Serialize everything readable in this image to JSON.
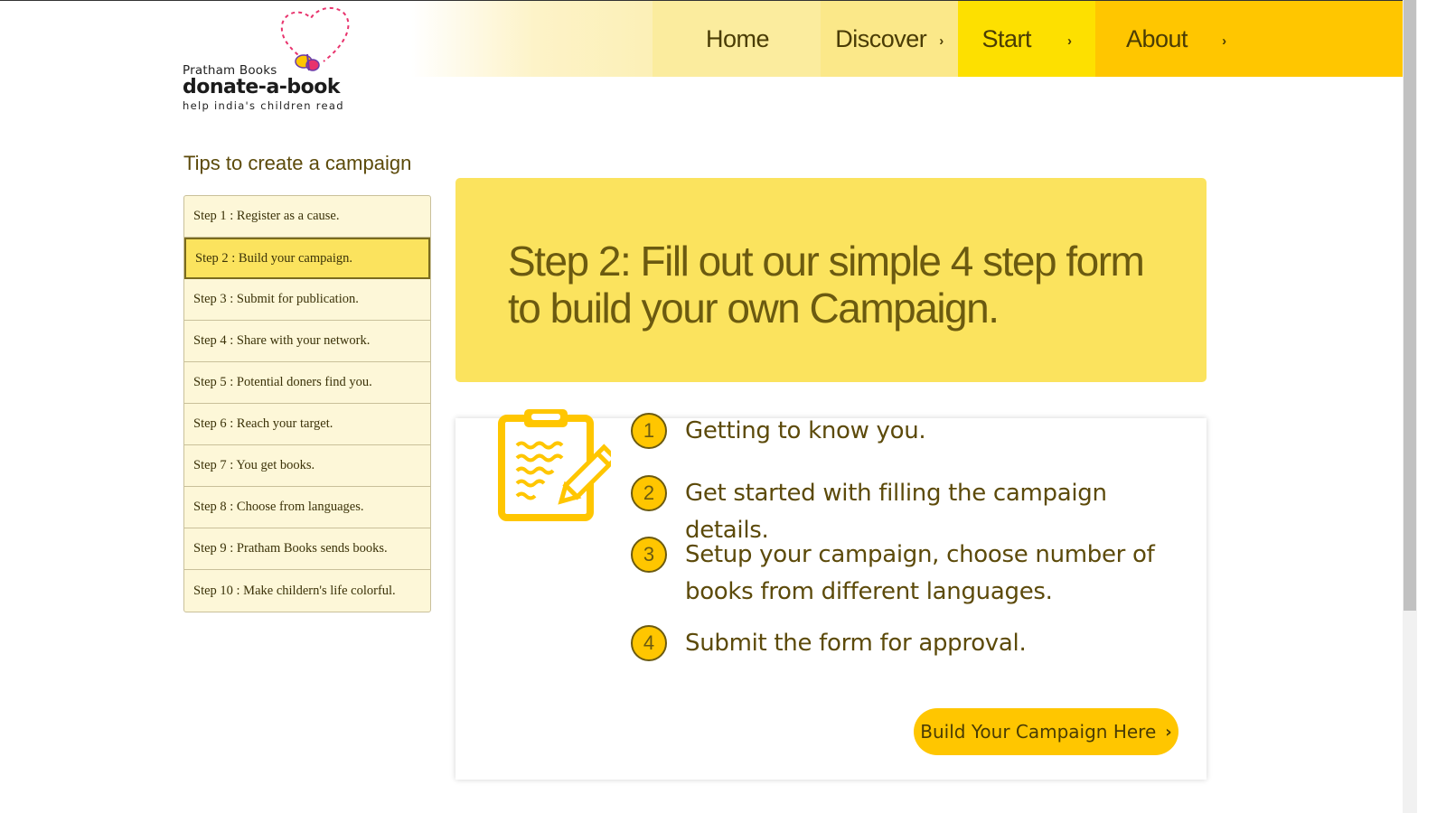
{
  "header": {
    "logo": {
      "brand_small": "Pratham Books",
      "brand_big": "donate-a-book",
      "tagline": "help india's children read"
    },
    "nav": [
      {
        "label": "Home",
        "has_chevron": false,
        "bg": "#fbec9e"
      },
      {
        "label": "Discover",
        "has_chevron": true,
        "bg": "#fbe889"
      },
      {
        "label": "Start",
        "has_chevron": true,
        "bg": "#fde000"
      },
      {
        "label": "About",
        "has_chevron": true,
        "bg": "#ffc600"
      }
    ],
    "chevron_glyph": "›"
  },
  "sidebar": {
    "title": "Tips to create a campaign",
    "active_index": 1,
    "steps": [
      {
        "label": "Step 1 : Register as a cause."
      },
      {
        "label": "Step 2 : Build your campaign."
      },
      {
        "label": "Step 3 : Submit for publication."
      },
      {
        "label": "Step 4 : Share with your network."
      },
      {
        "label": "Step 5 : Potential doners find you."
      },
      {
        "label": "Step 6 : Reach your target."
      },
      {
        "label": "Step 7 : You get books."
      },
      {
        "label": "Step 8 : Choose from languages."
      },
      {
        "label": "Step 9 : Pratham Books sends books."
      },
      {
        "label": "Step 10 : Make childern's life colorful."
      }
    ]
  },
  "main": {
    "heading": "Step 2: Fill out our simple 4 step form to build your own Campaign.",
    "icon": "clipboard-pencil-icon",
    "items": [
      {
        "number": "1",
        "text": "Getting to know you."
      },
      {
        "number": "2",
        "text": "Get started with filling the campaign details."
      },
      {
        "number": "3",
        "text": "Setup your campaign, choose number of books from different languages."
      },
      {
        "number": "4",
        "text": "Submit the form for approval."
      }
    ],
    "cta_label": "Build Your Campaign Here",
    "cta_icon": "›"
  },
  "colors": {
    "accent_yellow": "#ffc600",
    "hero_yellow": "#fbe35e",
    "text_brown": "#6b5a10",
    "logo_heart": "#e8336d"
  }
}
